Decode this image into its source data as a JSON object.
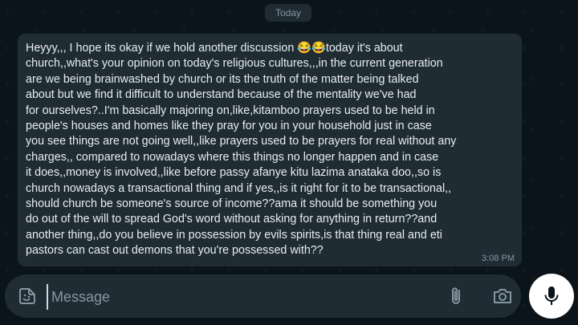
{
  "chat": {
    "date_label": "Today",
    "message": {
      "lines": [
        "Heyyy,,, I hope its okay if we hold another discussion 😂😂today it's about",
        "church,,what's your opinion on today's religious cultures,,,in the current generation",
        "are we being brainwashed by church or its the truth of the matter being talked",
        "about but we find it difficult to understand because of the mentality we've had",
        "for ourselves?..I'm basically majoring on,like,kitamboo prayers used to be held in",
        "people's houses and homes like they pray for you in your household just in case",
        "you see things are not going well,,like prayers used to be prayers for real without any",
        "charges,, compared to nowadays where this things no longer happen and in case",
        "it does,,money is involved,,like before passy afanye kitu lazima anataka doo,,so is",
        "church nowadays a transactional thing and if yes,,is it right for it to be transactional,,",
        "should church be someone's source of income??ama it should be something you",
        "do out of the will to spread God's word without asking for anything in return??and",
        "another thing,,do you believe in possession by evils spirits,is that thing real and eti",
        "pastors can cast out demons that you're possessed with??"
      ],
      "time": "3:08 PM"
    }
  },
  "composer": {
    "placeholder": "Message",
    "icons": {
      "sticker": "sticker-icon",
      "attach": "paperclip-icon",
      "camera": "camera-icon",
      "send": "mic-icon"
    }
  },
  "colors": {
    "background": "#0b141a",
    "bubble": "#1f2c34",
    "text": "#e9edef",
    "muted": "#8696a0"
  }
}
